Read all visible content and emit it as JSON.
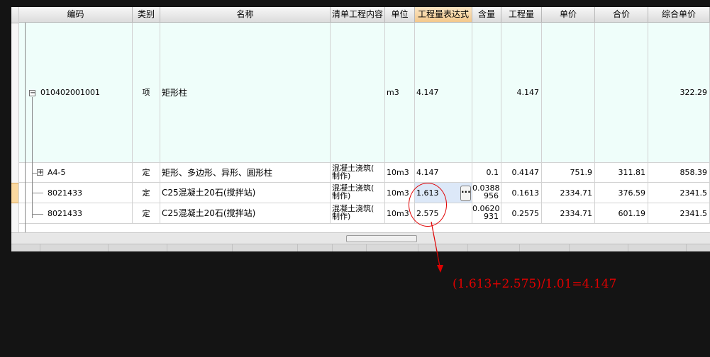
{
  "columns": [
    {
      "key": "code",
      "label": "编码"
    },
    {
      "key": "type",
      "label": "类别"
    },
    {
      "key": "name",
      "label": "名称"
    },
    {
      "key": "content",
      "label": "清单工程内容"
    },
    {
      "key": "unit",
      "label": "单位"
    },
    {
      "key": "expr",
      "label": "工程量表达式"
    },
    {
      "key": "ratio",
      "label": "含量"
    },
    {
      "key": "qty",
      "label": "工程量"
    },
    {
      "key": "price",
      "label": "单价"
    },
    {
      "key": "total",
      "label": "合价"
    },
    {
      "key": "comp",
      "label": "综合单价"
    }
  ],
  "rows": [
    {
      "code": "010402001001",
      "type": "项",
      "name": "矩形柱",
      "content": "",
      "unit": "m3",
      "expr": "4.147",
      "ratio": "",
      "qty": "4.147",
      "price": "",
      "total": "",
      "comp": "322.29",
      "tree": "minus"
    },
    {
      "code": "A4-5",
      "type": "定",
      "name": "矩形、多边形、异形、圆形柱",
      "content": "混凝土浇筑(制作)",
      "unit": "10m3",
      "expr": "4.147",
      "ratio": "0.1",
      "qty": "0.4147",
      "price": "751.9",
      "total": "311.81",
      "comp": "858.39",
      "tree": "plus"
    },
    {
      "code": "8021433",
      "type": "定",
      "name": "C25混凝土20石(搅拌站)",
      "content": "混凝土浇筑(制作)",
      "unit": "10m3",
      "expr": "1.613",
      "ratio": "0.0388956",
      "qty": "0.1613",
      "price": "2334.71",
      "total": "376.59",
      "comp": "2341.5",
      "tree": "none"
    },
    {
      "code": "8021433",
      "type": "定",
      "name": "C25混凝土20石(搅拌站)",
      "content": "混凝土浇筑(制作)",
      "unit": "10m3",
      "expr": "2.575",
      "ratio": "0.0620931",
      "qty": "0.2575",
      "price": "2334.71",
      "total": "601.19",
      "comp": "2341.5",
      "tree": "none"
    }
  ],
  "row0": {
    "code": "010402001001",
    "type": "项",
    "name": "矩形柱",
    "unit": "m3",
    "expr": "4.147",
    "qty": "4.147",
    "comp": "322.29"
  },
  "row1": {
    "code": "A4-5",
    "type": "定",
    "name": "矩形、多边形、异形、圆形柱",
    "content_a": "混凝土浇筑(",
    "content_b": "制作)",
    "unit": "10m3",
    "expr": "4.147",
    "ratio": "0.1",
    "qty": "0.4147",
    "price": "751.9",
    "total": "311.81",
    "comp": "858.39"
  },
  "row2": {
    "code": "8021433",
    "type": "定",
    "name": "C25混凝土20石(搅拌站)",
    "content_a": "混凝土浇筑(",
    "content_b": "制作)",
    "unit": "10m3",
    "expr": "1.613",
    "ratio_a": "0.0388",
    "ratio_b": "956",
    "qty": "0.1613",
    "price": "2334.71",
    "total": "376.59",
    "comp": "2341.5"
  },
  "row3": {
    "code": "8021433",
    "type": "定",
    "name": "C25混凝土20石(搅拌站)",
    "content_a": "混凝土浇筑(",
    "content_b": "制作)",
    "unit": "10m3",
    "expr": "2.575",
    "ratio_a": "0.0620",
    "ratio_b": "931",
    "qty": "0.2575",
    "price": "2334.71",
    "total": "601.19",
    "comp": "2341.5"
  },
  "ellipsis": "···",
  "annotation": "(1.613+2.575)/1.01=4.147",
  "colors": {
    "annotation": "#e00000",
    "row_highlight": "#effefa",
    "active_header": "#f3c88c"
  }
}
